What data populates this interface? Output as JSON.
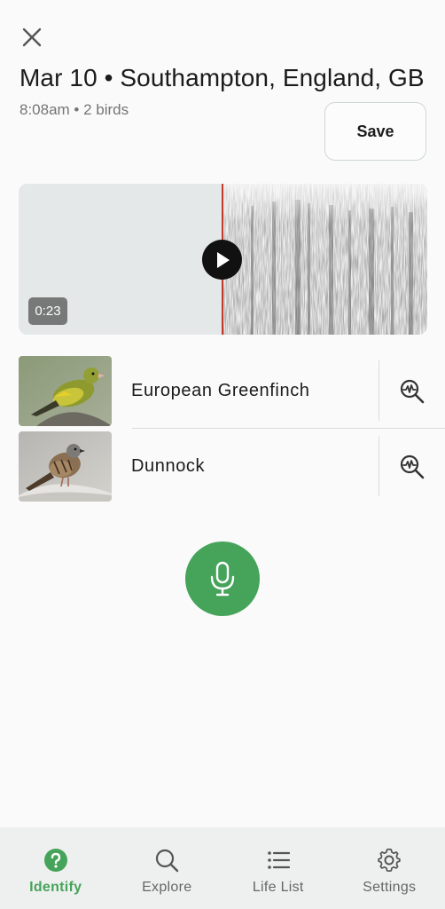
{
  "header": {
    "title": "Mar 10 • Southampton, England, GB",
    "subtitle": "8:08am • 2 birds",
    "save_label": "Save"
  },
  "player": {
    "duration": "0:23",
    "icons": {
      "play": "play-icon"
    }
  },
  "birds": [
    {
      "name": "European Greenfinch",
      "image": "greenfinch-photo",
      "action_icon": "analyze-waveform-icon"
    },
    {
      "name": "Dunnock",
      "image": "dunnock-photo",
      "action_icon": "analyze-waveform-icon"
    }
  ],
  "record": {
    "icon": "microphone-icon"
  },
  "nav": {
    "items": [
      {
        "label": "Identify",
        "icon": "identify-question-icon",
        "active": true
      },
      {
        "label": "Explore",
        "icon": "search-icon",
        "active": false
      },
      {
        "label": "Life List",
        "icon": "list-icon",
        "active": false
      },
      {
        "label": "Settings",
        "icon": "gear-icon",
        "active": false
      }
    ]
  },
  "colors": {
    "accent": "#46a35a",
    "playhead": "#c0392b",
    "spectrogram_bg": "#e4e8e8"
  }
}
